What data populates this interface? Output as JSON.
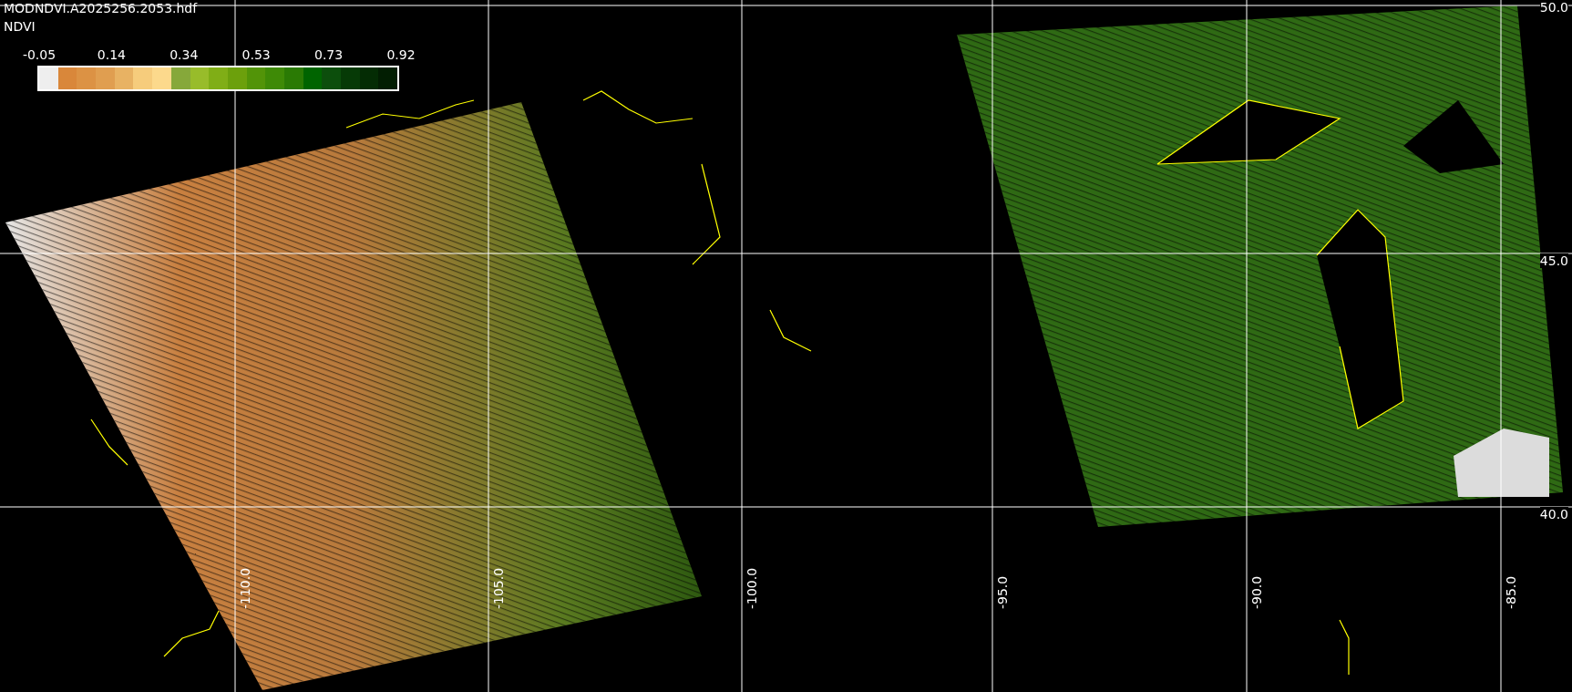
{
  "header": {
    "file_name": "MODNDVI.A2025256.2053.hdf",
    "variable": "NDVI"
  },
  "legend": {
    "ticks": [
      "-0.05",
      "0.14",
      "0.34",
      "0.53",
      "0.73",
      "0.92"
    ],
    "swatches": [
      {
        "color": "#eeeeee"
      },
      {
        "color": "#d9873a"
      },
      {
        "color": "#dc9244"
      },
      {
        "color": "#e09e50"
      },
      {
        "color": "#e8b263"
      },
      {
        "color": "#f6cc7c"
      },
      {
        "color": "#fcd98c"
      },
      {
        "color": "#86a83a"
      },
      {
        "color": "#98bc2a"
      },
      {
        "color": "#80ae16"
      },
      {
        "color": "#6ca00c"
      },
      {
        "color": "#529408"
      },
      {
        "color": "#3e8a06"
      },
      {
        "color": "#2a7a04"
      },
      {
        "color": "#006400"
      },
      {
        "color": "#0c4e0c"
      },
      {
        "color": "#063a06"
      },
      {
        "color": "#042c04"
      },
      {
        "color": "#021e02"
      }
    ]
  },
  "longitude_labels": [
    "-110.0",
    "-105.0",
    "-100.0",
    "-95.0",
    "-90.0",
    "-85.0"
  ],
  "latitude_labels": [
    "50.0",
    "45.0",
    "40.0"
  ]
}
